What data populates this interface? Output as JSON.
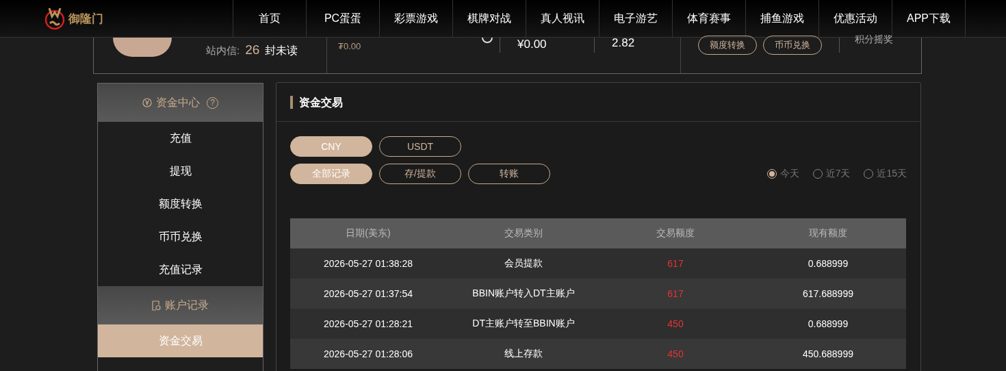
{
  "header": {
    "logo_text": "御隆门",
    "nav": [
      "首页",
      "PC蛋蛋",
      "彩票游戏",
      "棋牌对战",
      "真人视讯",
      "电子游艺",
      "体育赛事",
      "捕鱼游戏",
      "优惠活动",
      "APP下载"
    ]
  },
  "profile": {
    "messages_label": "站内信:",
    "messages_count": "26",
    "messages_unit": "封未读",
    "balances": [
      "₮0.00",
      "¥0.00",
      "2.82"
    ],
    "buttons": [
      "额度转换",
      "币币兑换"
    ],
    "lottery": "积分摇奖"
  },
  "sidebar": {
    "sections": [
      {
        "title": "资金中心",
        "help": "?",
        "items": [
          {
            "label": "充值",
            "selected": false
          },
          {
            "label": "提现",
            "selected": false
          },
          {
            "label": "额度转换",
            "selected": false
          },
          {
            "label": "币币兑换",
            "selected": false
          },
          {
            "label": "充值记录",
            "selected": false
          }
        ]
      },
      {
        "title": "账户记录",
        "items": [
          {
            "label": "资金交易",
            "selected": true
          }
        ]
      }
    ]
  },
  "main": {
    "title": "资金交易",
    "currency_tabs": [
      {
        "label": "CNY",
        "selected": true
      },
      {
        "label": "USDT",
        "selected": false
      }
    ],
    "filter_tabs": [
      {
        "label": "全部记录",
        "selected": true
      },
      {
        "label": "存/提款",
        "selected": false
      },
      {
        "label": "转账",
        "selected": false
      }
    ],
    "date_range": [
      {
        "label": "今天",
        "selected": true
      },
      {
        "label": "近7天",
        "selected": false
      },
      {
        "label": "近15天",
        "selected": false
      }
    ],
    "table": {
      "columns": [
        "日期(美东)",
        "交易类别",
        "交易额度",
        "现有额度"
      ],
      "rows": [
        [
          "2026-05-27 01:38:28",
          "会员提款",
          "617",
          "0.688999"
        ],
        [
          "2026-05-27 01:37:54",
          "BBIN账户转入DT主账户",
          "617",
          "617.688999"
        ],
        [
          "2026-05-27 01:28:21",
          "DT主账户转至BBIN账户",
          "450",
          "0.688999"
        ],
        [
          "2026-05-27 01:28:06",
          "线上存款",
          "450",
          "450.688999"
        ]
      ]
    }
  }
}
